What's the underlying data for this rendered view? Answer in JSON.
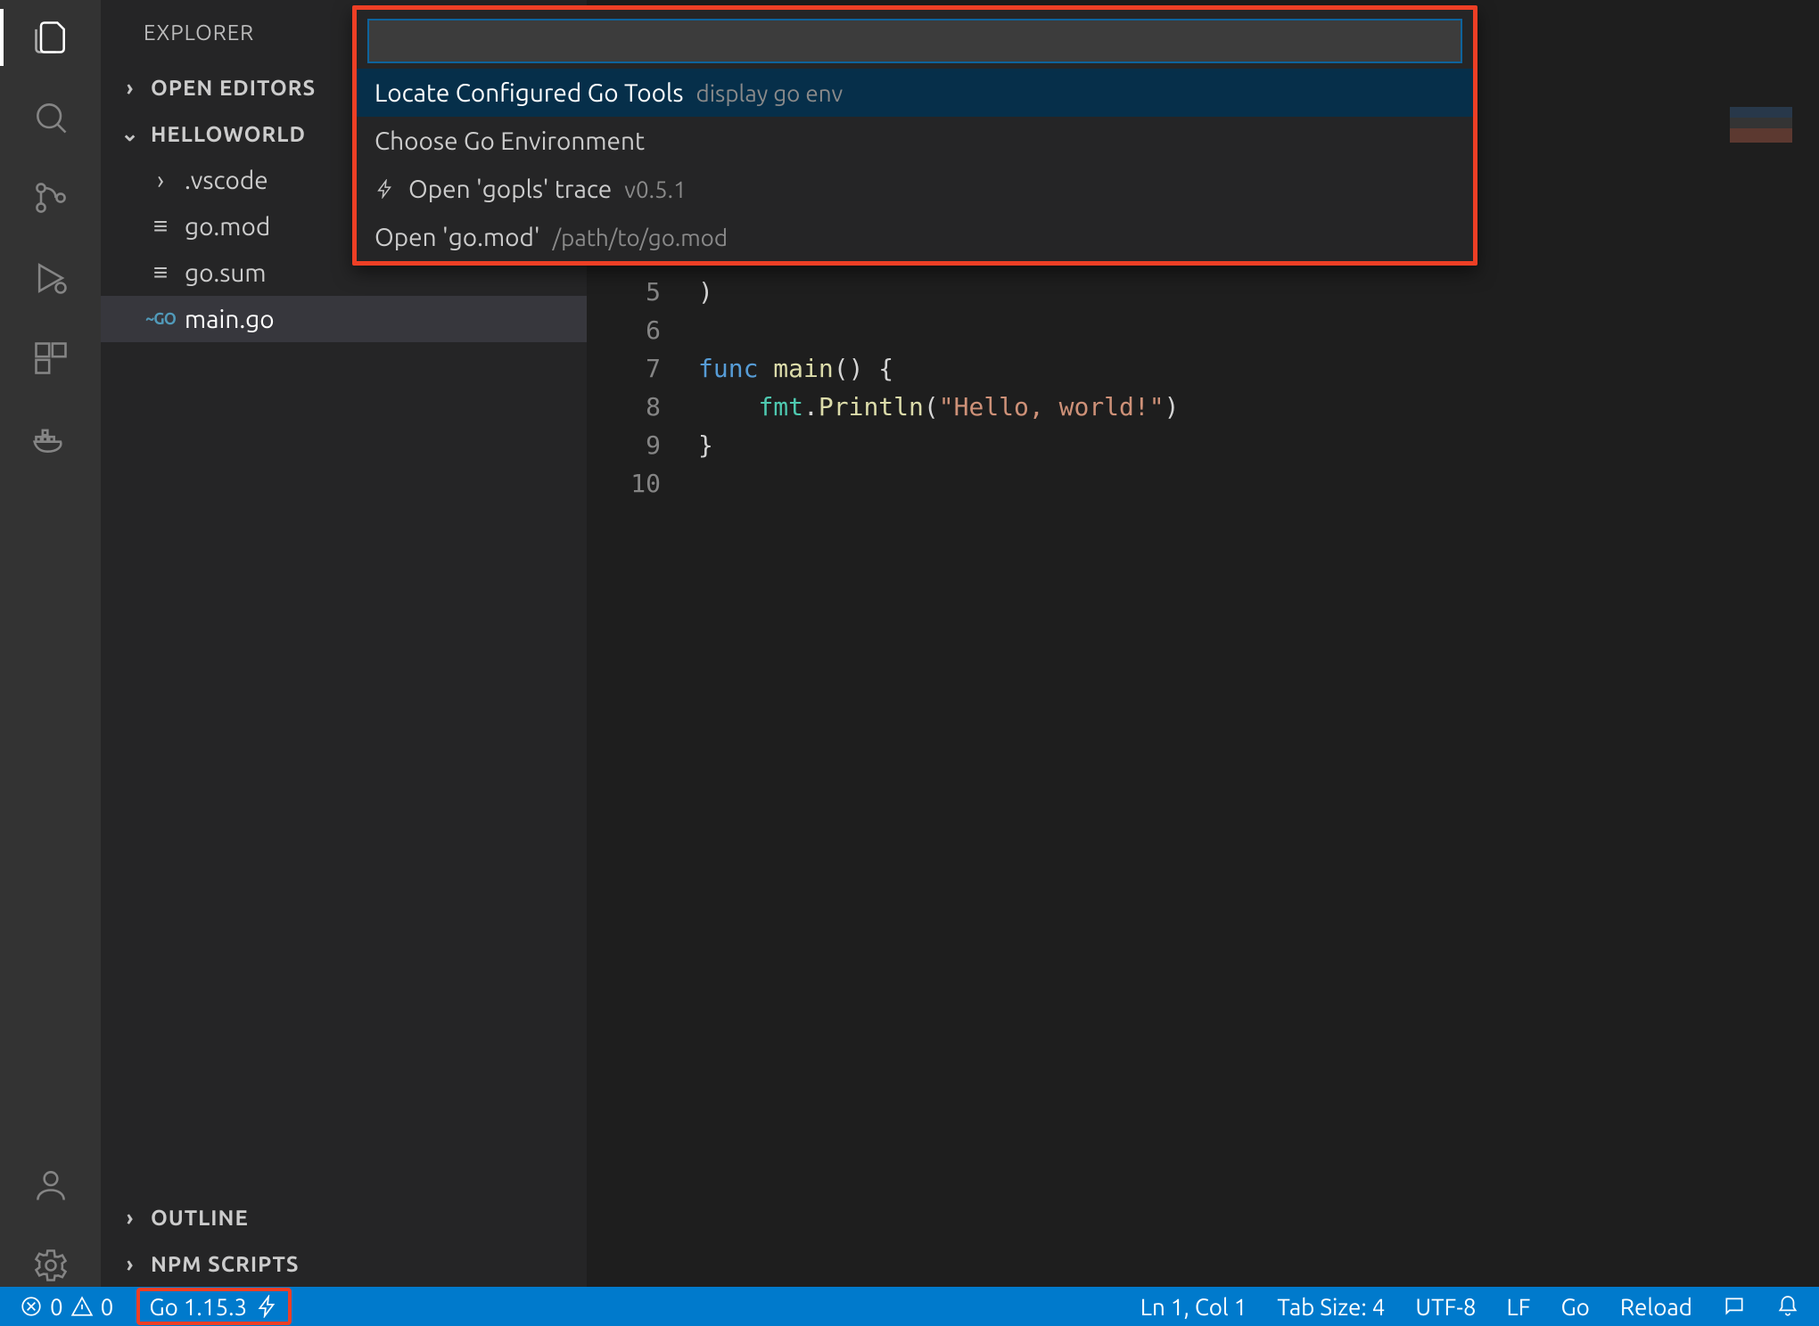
{
  "sidebar": {
    "title": "EXPLORER",
    "sections": {
      "open_editors": "OPEN EDITORS",
      "workspace": "HELLOWORLD",
      "outline": "OUTLINE",
      "npm": "NPM SCRIPTS"
    },
    "tree": {
      "vscode": ".vscode",
      "gomod": "go.mod",
      "gosum": "go.sum",
      "maingo": "main.go"
    }
  },
  "palette": {
    "items": [
      {
        "label": "Locate Configured Go Tools",
        "hint": "display go env"
      },
      {
        "label": "Choose Go Environment",
        "hint": ""
      },
      {
        "label": "Open 'gopls' trace",
        "hint": "v0.5.1",
        "icon": "zap"
      },
      {
        "label": "Open 'go.mod'",
        "hint": "/path/to/go.mod"
      }
    ]
  },
  "code": {
    "lines": [
      {
        "n": "5",
        "tokens": [
          {
            "t": ")",
            "c": "punct"
          }
        ]
      },
      {
        "n": "6",
        "tokens": []
      },
      {
        "n": "7",
        "tokens": [
          {
            "t": "func ",
            "c": "kw"
          },
          {
            "t": "main",
            "c": "fn"
          },
          {
            "t": "() {",
            "c": "punct"
          }
        ]
      },
      {
        "n": "8",
        "tokens": [
          {
            "t": "    ",
            "c": "punct"
          },
          {
            "t": "fmt",
            "c": "type"
          },
          {
            "t": ".",
            "c": "punct"
          },
          {
            "t": "Println",
            "c": "call"
          },
          {
            "t": "(",
            "c": "punct"
          },
          {
            "t": "\"Hello, world!\"",
            "c": "str"
          },
          {
            "t": ")",
            "c": "punct"
          }
        ]
      },
      {
        "n": "9",
        "tokens": [
          {
            "t": "}",
            "c": "punct"
          }
        ]
      },
      {
        "n": "10",
        "tokens": []
      }
    ]
  },
  "status": {
    "errors": "0",
    "warnings": "0",
    "go_version": "Go 1.15.3",
    "ln_col": "Ln 1, Col 1",
    "tab": "Tab Size: 4",
    "encoding": "UTF-8",
    "eol": "LF",
    "lang": "Go",
    "reload": "Reload"
  }
}
